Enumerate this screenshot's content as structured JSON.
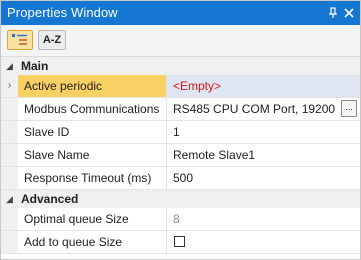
{
  "window": {
    "title": "Properties Window",
    "pin_icon": "pin-icon",
    "close_icon": "close-icon",
    "colors": {
      "titlebar": "#1577d1",
      "selected_name": "#f8d064",
      "selected_value": "#dde6f2",
      "empty_text": "#d21818"
    }
  },
  "toolbar": {
    "categorized_icon": "categorized-sort-icon",
    "alphabetical_label": "A-Z"
  },
  "categories": [
    {
      "label": "Main",
      "properties": [
        {
          "name": "Active periodic",
          "value": "<Empty>"
        },
        {
          "name": "Modbus Communications",
          "value": "RS485 CPU COM Port, 19200",
          "button_label": "..."
        },
        {
          "name": "Slave ID",
          "value": "1"
        },
        {
          "name": "Slave Name",
          "value": "Remote Slave1"
        },
        {
          "name": "Response Timeout (ms)",
          "value": "500"
        }
      ]
    },
    {
      "label": "Advanced",
      "properties": [
        {
          "name": "Optimal queue Size",
          "value": "8"
        },
        {
          "name": "Add to queue Size",
          "checked": false
        }
      ]
    }
  ]
}
